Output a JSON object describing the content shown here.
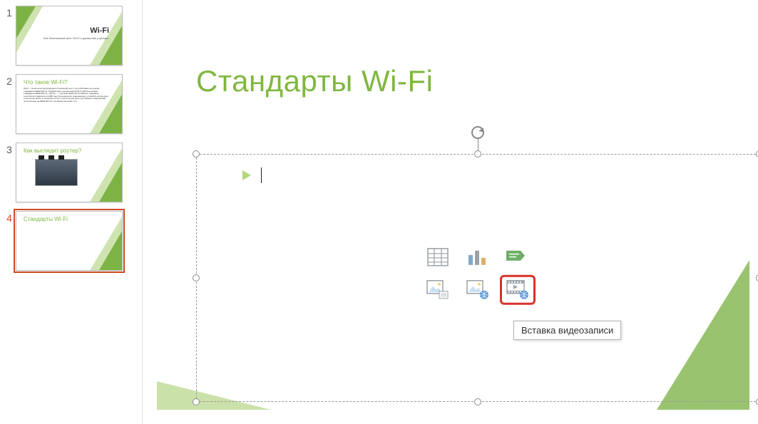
{
  "thumbs": [
    {
      "num": "1",
      "title": "Wi-Fi",
      "subtitle": "Все безопасный свет. Wi-Fi и домашние роутеры."
    },
    {
      "num": "2",
      "title": "Что такое Wi-Fi?",
      "body": "Wi-Fi – технология беспроводной локальной сети с устройствами на основе стандартов IEEE 802.11. Разработано консорциумом Wi-Fi Alliance на базе стандартов IEEE 802.11, «Wi-Fi» — торговая марка Wi-Fi Alliance. Название технологии появилось в 1985 году. Большинство современных устройств используют технологию Wi-Fi, в особенности это относится как раз к ноутбукам и смартфонам построенных на IEEE 802.11. На самом как мирят это."
    },
    {
      "num": "3",
      "title": "Как выглядит роутер?"
    },
    {
      "num": "4",
      "title": "Стандарты Wi-Fi"
    }
  ],
  "slide": {
    "title": "Стандарты Wi-Fi",
    "tooltip": "Вставка видеозаписи"
  },
  "icons": {
    "table": "table-icon",
    "chart": "chart-icon",
    "smartart": "smartart-icon",
    "picture": "picture-icon",
    "online_picture": "online-picture-icon",
    "video": "video-icon"
  }
}
